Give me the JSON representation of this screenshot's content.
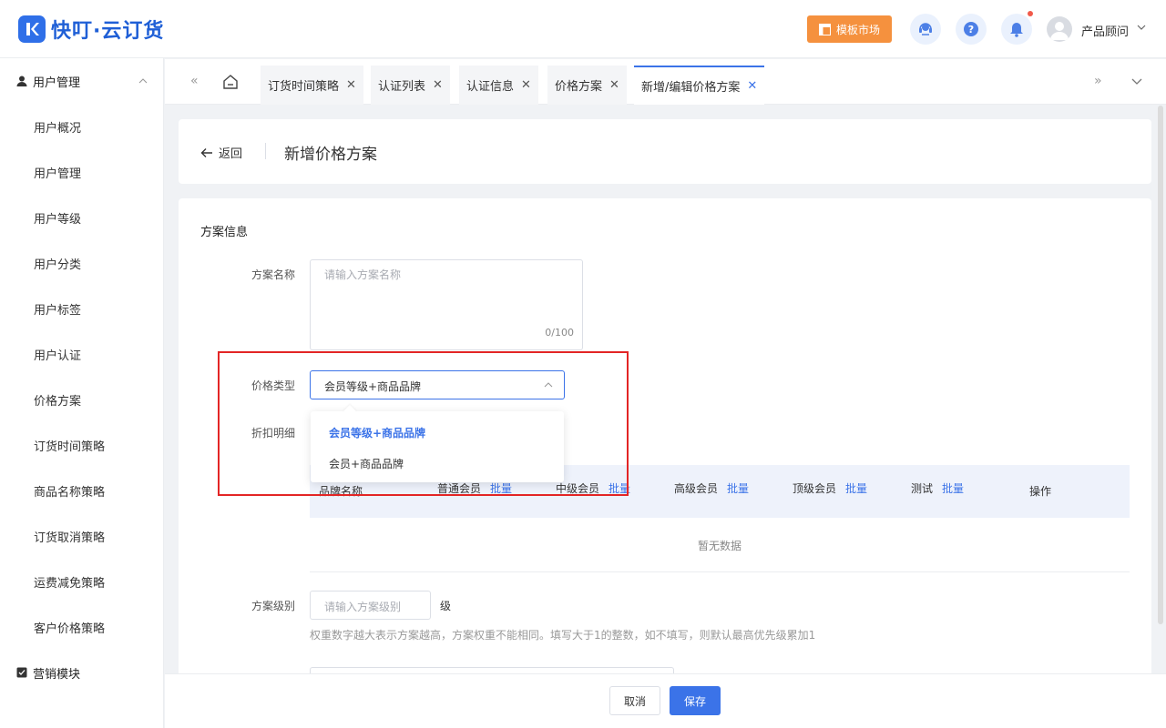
{
  "header": {
    "brand": "快叮·云订货",
    "market_label": "模板市场",
    "user_name": "产品顾问",
    "icons": [
      "headset-icon",
      "help-icon",
      "bell-icon",
      "user-avatar-icon"
    ]
  },
  "sidebar": {
    "group_label": "用户管理",
    "items": [
      "用户概况",
      "用户管理",
      "用户等级",
      "用户分类",
      "用户标签",
      "用户认证",
      "价格方案",
      "订货时间策略",
      "商品名称策略",
      "订货取消策略",
      "运费减免策略",
      "客户价格策略"
    ],
    "next_group_label": "营销模块"
  },
  "tabs": [
    {
      "label": "订货时间策略"
    },
    {
      "label": "认证列表"
    },
    {
      "label": "认证信息"
    },
    {
      "label": "价格方案"
    },
    {
      "label": "新增/编辑价格方案",
      "active": true
    }
  ],
  "title_card": {
    "back_label": "返回",
    "title": "新增价格方案"
  },
  "form": {
    "section_title": "方案信息",
    "name_label": "方案名称",
    "name_placeholder": "请输入方案名称",
    "name_counter": "0/100",
    "price_type_label": "价格类型",
    "price_type_value": "会员等级+商品品牌",
    "discount_label": "折扣明细",
    "dropdown_options": [
      {
        "label": "会员等级+商品品牌",
        "selected": true
      },
      {
        "label": "会员+商品品牌",
        "selected": false
      }
    ],
    "table": {
      "col_brand": "品牌名称",
      "col_normal": "普通会员",
      "col_mid": "中级会员",
      "col_high": "高级会员",
      "col_top": "顶级会员",
      "col_test": "测试",
      "col_action": "操作",
      "batch_label": "批量",
      "empty_text": "暂无数据"
    },
    "level_label": "方案级别",
    "level_placeholder": "请输入方案级别",
    "level_unit": "级",
    "level_hint": "权重数字越大表示方案越高，方案权重不能相同。填写大于1的整数，如不填写，则默认最高优先级累加1"
  },
  "footer": {
    "cancel_label": "取消",
    "save_label": "保存"
  },
  "colors": {
    "primary": "#3b73e8",
    "market": "#f5913e",
    "highlight_box": "#e32525"
  }
}
